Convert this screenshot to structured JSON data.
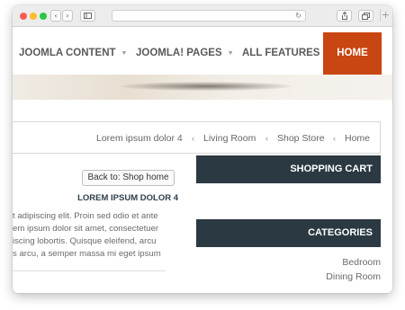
{
  "browser": {
    "back_icon": "chevron-left-icon",
    "forward_icon": "chevron-right-icon",
    "sidebar_icon": "sidebar-icon",
    "reload_icon": "reload-icon",
    "share_icon": "share-icon",
    "tabs_icon": "tabs-icon",
    "new_tab_icon": "plus-icon",
    "glyph_back": "‹",
    "glyph_forward": "›",
    "glyph_reload": "↻",
    "glyph_plus": "+"
  },
  "nav": {
    "items": [
      {
        "label": "JOOMLA CONTENT",
        "caret": "▼"
      },
      {
        "label": "JOOMLA! PAGES",
        "caret": "▼"
      },
      {
        "label": "ALL FEATURES",
        "caret": "▼"
      }
    ],
    "home_label": "HOME",
    "home_color": "#c94511"
  },
  "breadcrumb": {
    "items": [
      "Lorem ipsum dolor 4",
      "Living Room",
      "Shop Store",
      "Home"
    ],
    "separator": "‹"
  },
  "product": {
    "back_label": "Back to: Shop home",
    "title": "LOREM IPSUM DOLOR 4",
    "description_lines": [
      "t adipiscing elit. Proin sed odio et ante",
      "em ipsum dolor sit amet, consectetuer",
      "iscing lobortis. Quisque eleifend, arcu",
      "s arcu, a semper massa mi eget ipsum"
    ]
  },
  "sidebar": {
    "shopping_cart_title": "SHOPPING CART",
    "categories_title": "CATEGORIES",
    "categories": [
      "Bedroom",
      "Dining Room"
    ],
    "header_color": "#2b3942"
  }
}
